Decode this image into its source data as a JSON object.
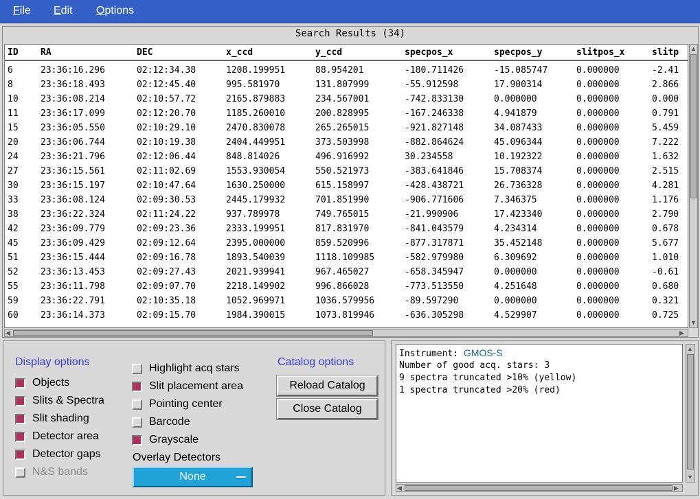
{
  "menu": {
    "file": "File",
    "edit": "Edit",
    "options": "Options"
  },
  "results": {
    "title": "Search Results (34)",
    "columns": [
      "ID",
      "RA",
      "DEC",
      "x_ccd",
      "y_ccd",
      "specpos_x",
      "specpos_y",
      "slitpos_x",
      "slitp"
    ],
    "rows": [
      [
        "6",
        "23:36:16.296",
        "02:12:34.38",
        "1208.199951",
        "88.954201",
        "-180.711426",
        "-15.085747",
        "0.000000",
        "-2.41"
      ],
      [
        "8",
        "23:36:18.493",
        "02:12:45.40",
        "995.581970",
        "131.807999",
        "-55.912598",
        "17.900314",
        "0.000000",
        "2.866"
      ],
      [
        "10",
        "23:36:08.214",
        "02:10:57.72",
        "2165.879883",
        "234.567001",
        "-742.833130",
        "0.000000",
        "0.000000",
        "0.000"
      ],
      [
        "11",
        "23:36:17.099",
        "02:12:20.70",
        "1185.260010",
        "200.828995",
        "-167.246338",
        "4.941879",
        "0.000000",
        "0.791"
      ],
      [
        "15",
        "23:36:05.550",
        "02:10:29.10",
        "2470.830078",
        "265.265015",
        "-921.827148",
        "34.087433",
        "0.000000",
        "5.459"
      ],
      [
        "20",
        "23:36:06.744",
        "02:10:19.38",
        "2404.449951",
        "373.503998",
        "-882.864624",
        "45.096344",
        "0.000000",
        "7.222"
      ],
      [
        "24",
        "23:36:21.796",
        "02:12:06.44",
        "848.814026",
        "496.916992",
        "30.234558",
        "10.192322",
        "0.000000",
        "1.632"
      ],
      [
        "27",
        "23:36:15.561",
        "02:11:02.69",
        "1553.930054",
        "550.521973",
        "-383.641846",
        "15.708374",
        "0.000000",
        "2.515"
      ],
      [
        "30",
        "23:36:15.197",
        "02:10:47.64",
        "1630.250000",
        "615.158997",
        "-428.438721",
        "26.736328",
        "0.000000",
        "4.281"
      ],
      [
        "33",
        "23:36:08.124",
        "02:09:30.53",
        "2445.179932",
        "701.851990",
        "-906.771606",
        "7.346375",
        "0.000000",
        "1.176"
      ],
      [
        "38",
        "23:36:22.324",
        "02:11:24.22",
        "937.789978",
        "749.765015",
        "-21.990906",
        "17.423340",
        "0.000000",
        "2.790"
      ],
      [
        "42",
        "23:36:09.779",
        "02:09:23.36",
        "2333.199951",
        "817.831970",
        "-841.043579",
        "4.234314",
        "0.000000",
        "0.678"
      ],
      [
        "45",
        "23:36:09.429",
        "02:09:12.64",
        "2395.000000",
        "859.520996",
        "-877.317871",
        "35.452148",
        "0.000000",
        "5.677"
      ],
      [
        "51",
        "23:36:15.444",
        "02:09:16.78",
        "1893.540039",
        "1118.109985",
        "-582.979980",
        "6.309692",
        "0.000000",
        "1.010"
      ],
      [
        "52",
        "23:36:13.453",
        "02:09:27.43",
        "2021.939941",
        "967.465027",
        "-658.345947",
        "0.000000",
        "0.000000",
        "-0.61"
      ],
      [
        "55",
        "23:36:11.798",
        "02:09:07.70",
        "2218.149902",
        "996.866028",
        "-773.513550",
        "4.251648",
        "0.000000",
        "0.680"
      ],
      [
        "59",
        "23:36:22.791",
        "02:10:35.18",
        "1052.969971",
        "1036.579956",
        "-89.597290",
        "0.000000",
        "0.000000",
        "0.321"
      ],
      [
        "60",
        "23:36:14.373",
        "02:09:15.70",
        "1984.390015",
        "1073.819946",
        "-636.305298",
        "4.529907",
        "0.000000",
        "0.725"
      ]
    ]
  },
  "display_options": {
    "title": "Display options",
    "items": [
      {
        "label": "Objects",
        "checked": true,
        "enabled": true
      },
      {
        "label": "Slits & Spectra",
        "checked": true,
        "enabled": true
      },
      {
        "label": "Slit shading",
        "checked": true,
        "enabled": true
      },
      {
        "label": "Detector area",
        "checked": true,
        "enabled": true
      },
      {
        "label": "Detector gaps",
        "checked": true,
        "enabled": true
      },
      {
        "label": "N&S bands",
        "checked": false,
        "enabled": false
      }
    ]
  },
  "display_options_2": {
    "items": [
      {
        "label": "Highlight acq stars",
        "checked": false
      },
      {
        "label": "Slit placement area",
        "checked": true
      },
      {
        "label": "Pointing center",
        "checked": false
      },
      {
        "label": "Barcode",
        "checked": false
      },
      {
        "label": "Grayscale",
        "checked": true
      }
    ],
    "overlay_label": "Overlay Detectors",
    "overlay_value": "None"
  },
  "catalog_options": {
    "title": "Catalog options",
    "reload_label": "Reload Catalog",
    "close_label": "Close Catalog"
  },
  "info": {
    "instrument_label": "Instrument: ",
    "instrument_value": "GMOS-S",
    "line2": "Number of good acq. stars: 3",
    "line3": "9 spectra truncated >10% (yellow)",
    "line4": "1 spectra truncated >20% (red)"
  },
  "colors": {
    "menubar": "#3560c8",
    "accent_title": "#3a3ad0",
    "checked": "#b03060",
    "dropdown": "#1fa3d8",
    "instrument": "#1a6a8a"
  }
}
